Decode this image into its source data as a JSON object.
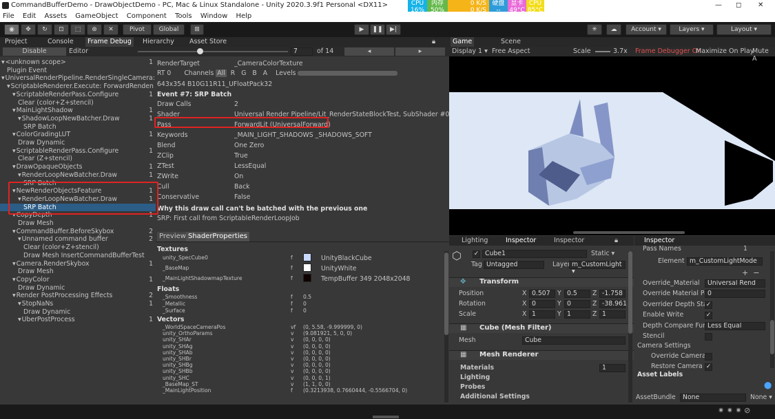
{
  "window": {
    "title": "CommandBufferDemo - DrawObjectDemo - PC, Mac & Linux Standalone - Unity 2020.3.9f1 Personal <DX11>",
    "minimize": "—",
    "maximize": "◻",
    "close": "✕"
  },
  "sysmon": {
    "cpu": "CPU",
    "cpu_val": "16%",
    "mem": "内存",
    "mem_val": "50%",
    "net_up": "0 K/S",
    "net_down": "0 K/S",
    "gpu_label": "硬盘",
    "gpu_val": "--",
    "vram": "显卡",
    "vram_val": "49°C",
    "cpu2": "CPU",
    "cpu2_val": "85°C"
  },
  "menu": [
    "File",
    "Edit",
    "Assets",
    "GameObject",
    "Component",
    "Tools",
    "Window",
    "Help"
  ],
  "toolbar": {
    "pivot": "Pivot",
    "global": "Global",
    "account": "Account ▾",
    "layers": "Layers ▾",
    "layout": "Layout ▾"
  },
  "tabs": {
    "project": "Project",
    "console": "Console",
    "frame_debug": "Frame Debug",
    "hierarchy": "Hierarchy",
    "asset_store": "Asset Store"
  },
  "fd": {
    "disable": "Disable",
    "editor": "Editor",
    "frame": "7",
    "of": "of 14"
  },
  "tree": [
    {
      "t": "<unknown scope>",
      "n": "1",
      "i": 0
    },
    {
      "t": "Plugin Event",
      "n": "",
      "i": 1
    },
    {
      "t": "UniversalRenderPipeline.RenderSingleCamera: 13",
      "n": "",
      "i": 0
    },
    {
      "t": "ScriptableRenderer.Execute: ForwardRenden 13",
      "n": "",
      "i": 1
    },
    {
      "t": "ScriptableRenderPass.Configure",
      "n": "1",
      "i": 2
    },
    {
      "t": "Clear (color+Z+stencil)",
      "n": "",
      "i": 3
    },
    {
      "t": "MainLightShadow",
      "n": "1",
      "i": 2
    },
    {
      "t": "ShadowLoopNewBatcher.Draw",
      "n": "1",
      "i": 3
    },
    {
      "t": "SRP Batch",
      "n": "",
      "i": 4
    },
    {
      "t": "ColorGradingLUT",
      "n": "1",
      "i": 2
    },
    {
      "t": "Draw Dynamic",
      "n": "",
      "i": 3
    },
    {
      "t": "ScriptableRenderPass.Configure",
      "n": "1",
      "i": 2
    },
    {
      "t": "Clear (Z+stencil)",
      "n": "",
      "i": 3
    },
    {
      "t": "DrawOpaqueObjects",
      "n": "1",
      "i": 2
    },
    {
      "t": "RenderLoopNewBatcher.Draw",
      "n": "1",
      "i": 3
    },
    {
      "t": "SRP Batch",
      "n": "",
      "i": 4
    },
    {
      "t": "NewRenderObjectsFeature",
      "n": "1",
      "i": 2
    },
    {
      "t": "RenderLoopNewBatcher.Draw",
      "n": "1",
      "i": 3
    },
    {
      "t": "SRP Batch",
      "n": "",
      "i": 4,
      "sel": true
    },
    {
      "t": "CopyDepth",
      "n": "1",
      "i": 2
    },
    {
      "t": "Draw Mesh",
      "n": "",
      "i": 3
    },
    {
      "t": "CommandBuffer.BeforeSkybox",
      "n": "2",
      "i": 2
    },
    {
      "t": "Unnamed command buffer",
      "n": "2",
      "i": 3
    },
    {
      "t": "Clear (color+Z+stencil)",
      "n": "",
      "i": 4
    },
    {
      "t": "Draw Mesh InsertCommandBufferTest",
      "n": "",
      "i": 4
    },
    {
      "t": "Camera.RenderSkybox",
      "n": "1",
      "i": 2
    },
    {
      "t": "Draw Mesh",
      "n": "",
      "i": 3
    },
    {
      "t": "CopyColor",
      "n": "1",
      "i": 2
    },
    {
      "t": "Draw Dynamic",
      "n": "",
      "i": 3
    },
    {
      "t": "Render PostProcessing Effects",
      "n": "2",
      "i": 2
    },
    {
      "t": "StopNaNs",
      "n": "1",
      "i": 3
    },
    {
      "t": "Draw Dynamic",
      "n": "",
      "i": 4
    },
    {
      "t": "UberPostProcess",
      "n": "1",
      "i": 3
    }
  ],
  "detail": {
    "render_target_label": "RenderTarget",
    "render_target": "_CameraColorTexture",
    "rt": "RT 0",
    "channels": "Channels",
    "all": "All",
    "r": "R",
    "g": "G",
    "b": "B",
    "a": "A",
    "levels": "Levels",
    "format": "643x354 B10G11R11_UFloatPack32",
    "event": "Event #7: SRP Batch",
    "props": [
      {
        "k": "Draw Calls",
        "v": "2"
      },
      {
        "k": "Shader",
        "v": "Universal Render Pipeline/Lit_RenderStateBlockTest, SubShader #0"
      },
      {
        "k": "Pass",
        "v": "ForwardLit (UniversalForward)"
      },
      {
        "k": "Keywords",
        "v": "_MAIN_LIGHT_SHADOWS _SHADOWS_SOFT"
      },
      {
        "k": "Blend",
        "v": "One Zero"
      },
      {
        "k": "ZClip",
        "v": "True"
      },
      {
        "k": "ZTest",
        "v": "LessEqual"
      },
      {
        "k": "ZWrite",
        "v": "On"
      },
      {
        "k": "Cull",
        "v": "Back"
      },
      {
        "k": "Conservative",
        "v": "False"
      }
    ],
    "why": "Why this draw call can't be batched with the previous one",
    "why2": "SRP: First call from ScriptableRenderLoopJob",
    "tab_preview": "Preview",
    "tab_shader": "ShaderProperties",
    "textures_label": "Textures",
    "textures": [
      {
        "k": "unity_SpecCube0",
        "f": "f",
        "v": "UnityBlackCube"
      },
      {
        "k": "_BaseMap",
        "f": "f",
        "v": "UnityWhite"
      },
      {
        "k": "_MainLightShadowmapTexture",
        "f": "f",
        "v": "TempBuffer 349 2048x2048"
      }
    ],
    "floats_label": "Floats",
    "floats": [
      {
        "k": "_Smoothness",
        "f": "f",
        "v": "0.5"
      },
      {
        "k": "_Metallic",
        "f": "f",
        "v": "0"
      },
      {
        "k": "_Surface",
        "f": "f",
        "v": "0"
      }
    ],
    "vectors_label": "Vectors",
    "vectors": [
      {
        "k": "_WorldSpaceCameraPos",
        "f": "vf",
        "v": "(0, 5.58, -9.999999, 0)"
      },
      {
        "k": "unity_OrthoParams",
        "f": "v",
        "v": "(9.081921, 5, 0, 0)"
      },
      {
        "k": "unity_SHAr",
        "f": "v",
        "v": "(0, 0, 0, 0)"
      },
      {
        "k": "unity_SHAg",
        "f": "v",
        "v": "(0, 0, 0, 0)"
      },
      {
        "k": "unity_SHAb",
        "f": "v",
        "v": "(0, 0, 0, 0)"
      },
      {
        "k": "unity_SHBr",
        "f": "v",
        "v": "(0, 0, 0, 0)"
      },
      {
        "k": "unity_SHBg",
        "f": "v",
        "v": "(0, 0, 0, 0)"
      },
      {
        "k": "unity_SHBb",
        "f": "v",
        "v": "(0, 0, 0, 0)"
      },
      {
        "k": "unity_SHC",
        "f": "v",
        "v": "(0, 0, 0, 1)"
      },
      {
        "k": "_BaseMap_ST",
        "f": "v",
        "v": "(1, 1, 0, 0)"
      },
      {
        "k": "_MainLightPosition",
        "f": "f",
        "v": "(0.3213938, 0.7660444, -0.5566704, 0)"
      }
    ]
  },
  "game": {
    "tab_game": "Game",
    "tab_scene": "Scene",
    "display": "Display 1 ▾",
    "aspect": "Free Aspect",
    "scale": "Scale",
    "scale_val": "3.7x",
    "fd_on": "Frame Debugger On",
    "maximize": "Maximize On Play",
    "mute": "Mute A"
  },
  "inspector": {
    "tab_lighting": "Lighting",
    "tab_inspector": "Inspector",
    "tab_inspector2": "Inspector",
    "name": "Cube1",
    "static": "Static ▾",
    "tag_label": "Tag",
    "tag": "Untagged",
    "layer_label": "Layer",
    "layer": "m_CustomLight ▾",
    "transform": "Transform",
    "position": "Position",
    "rotation": "Rotation",
    "scale": "Scale",
    "pos": [
      "0.507",
      "0.5",
      "-1.758"
    ],
    "rot": [
      "0",
      "0",
      "-38.961"
    ],
    "scl": [
      "1",
      "1",
      "1"
    ],
    "meshfilter": "Cube (Mesh Filter)",
    "mesh_label": "Mesh",
    "mesh": "Cube",
    "meshrenderer": "Mesh Renderer",
    "materials": "Materials",
    "materials_n": "1",
    "lighting": "Lighting",
    "probes": "Probes",
    "additional": "Additional Settings"
  },
  "inspector2": {
    "tab": "Inspector",
    "pass_names": "Pass Names",
    "pass_n": "1",
    "element": "Element 0",
    "element_val": "m_CustomLightMode",
    "props": [
      {
        "k": "Override_Material",
        "v": "Universal Rend"
      },
      {
        "k": "Override Material Pa",
        "v": "0"
      },
      {
        "k": "Overrider Depth Stat",
        "v": "✓"
      },
      {
        "k": "Enable Write",
        "v": "✓"
      },
      {
        "k": "Depth Compare Func",
        "v": "Less Equal"
      },
      {
        "k": "Stencil",
        "v": ""
      }
    ],
    "camera_settings": "Camera Settings",
    "override_camera": "Override Camera",
    "restore_camera": "Restore Camera",
    "asset_labels": "Asset Labels",
    "asset_bundle": "AssetBundle",
    "ab_val": "None",
    "ab_val2": "None ▾"
  },
  "colors": {
    "accent": "#2c5d87",
    "highlight": "#e12222",
    "sky": "#dde7f5"
  }
}
